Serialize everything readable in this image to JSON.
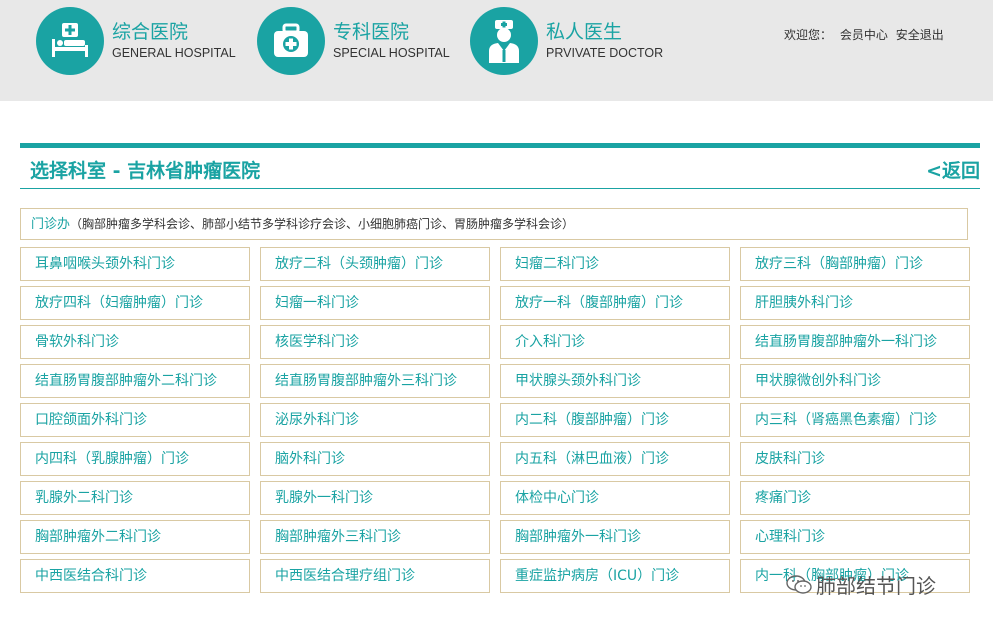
{
  "header": {
    "nav": [
      {
        "cn": "综合医院",
        "en": "GENERAL HOSPITAL",
        "icon": "hospital-bed-icon"
      },
      {
        "cn": "专科医院",
        "en": "SPECIAL HOSPITAL",
        "icon": "medical-kit-icon"
      },
      {
        "cn": "私人医生",
        "en": "PRVIVATE DOCTOR",
        "icon": "doctor-icon"
      }
    ],
    "welcome": "欢迎您：",
    "member_center": "会员中心",
    "logout": "安全退出"
  },
  "panel": {
    "title": "选择科室 - 吉林省肿瘤医院",
    "back": "<返回"
  },
  "outpatient": {
    "main": "门诊办",
    "sub": "（胸部肿瘤多学科会诊、肺部小结节多学科诊疗会诊、小细胞肺癌门诊、胃肠肿瘤多学科会诊）"
  },
  "departments": [
    "耳鼻咽喉头颈外科门诊",
    "放疗二科（头颈肿瘤）门诊",
    "妇瘤二科门诊",
    "放疗三科（胸部肿瘤）门诊",
    "放疗四科（妇瘤肿瘤）门诊",
    "妇瘤一科门诊",
    "放疗一科（腹部肿瘤）门诊",
    "肝胆胰外科门诊",
    "骨软外科门诊",
    "核医学科门诊",
    "介入科门诊",
    "结直肠胃腹部肿瘤外一科门诊",
    "结直肠胃腹部肿瘤外二科门诊",
    "结直肠胃腹部肿瘤外三科门诊",
    "甲状腺头颈外科门诊",
    "甲状腺微创外科门诊",
    "口腔颌面外科门诊",
    "泌尿外科门诊",
    "内二科（腹部肿瘤）门诊",
    "内三科（肾癌黑色素瘤）门诊",
    "内四科（乳腺肿瘤）门诊",
    "脑外科门诊",
    "内五科（淋巴血液）门诊",
    "皮肤科门诊",
    "乳腺外二科门诊",
    "乳腺外一科门诊",
    "体检中心门诊",
    "疼痛门诊",
    "胸部肿瘤外二科门诊",
    "胸部肿瘤外三科门诊",
    "胸部肿瘤外一科门诊",
    "心理科门诊",
    "中西医结合科门诊",
    "中西医结合理疗组门诊",
    "重症监护病房（ICU）门诊",
    "内一科（胸部肿瘤）门诊"
  ],
  "watermark": {
    "text": "肺部结节门诊",
    "icon": "wechat-icon"
  },
  "colors": {
    "accent": "#1aa3a3",
    "border": "#d9c9a3",
    "header_bg": "#e8e8e8"
  }
}
